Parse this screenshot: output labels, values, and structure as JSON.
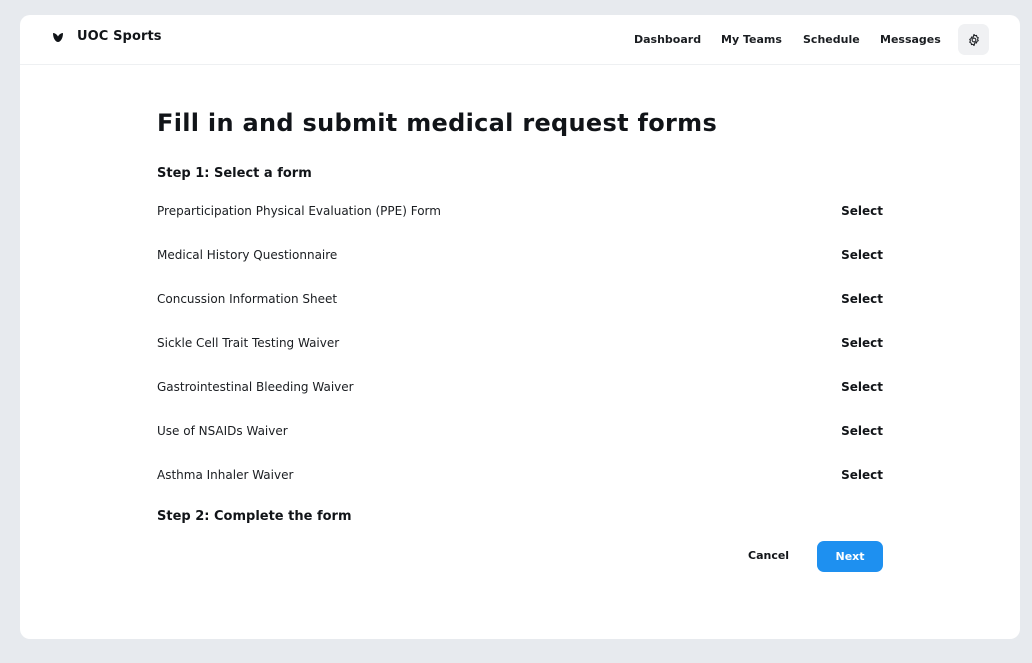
{
  "brand": {
    "name": "UOC Sports",
    "logo_icon": "leaf-icon"
  },
  "nav": {
    "items": [
      {
        "label": "Dashboard"
      },
      {
        "label": "My Teams"
      },
      {
        "label": "Schedule"
      },
      {
        "label": "Messages"
      }
    ],
    "settings_icon": "gear-icon"
  },
  "page": {
    "title": "Fill in and submit medical request forms",
    "step1": "Step 1: Select a form",
    "step2": "Step 2: Complete the form"
  },
  "forms": [
    {
      "name": "Preparticipation Physical Evaluation (PPE) Form",
      "action": "Select"
    },
    {
      "name": "Medical History Questionnaire",
      "action": "Select"
    },
    {
      "name": "Concussion Information Sheet",
      "action": "Select"
    },
    {
      "name": "Sickle Cell Trait Testing Waiver",
      "action": "Select"
    },
    {
      "name": "Gastrointestinal Bleeding Waiver",
      "action": "Select"
    },
    {
      "name": "Use of NSAIDs Waiver",
      "action": "Select"
    },
    {
      "name": "Asthma Inhaler Waiver",
      "action": "Select"
    }
  ],
  "actions": {
    "cancel": "Cancel",
    "next": "Next"
  },
  "colors": {
    "accent": "#1e90f0",
    "background": "#e7eaee",
    "card": "#ffffff"
  }
}
